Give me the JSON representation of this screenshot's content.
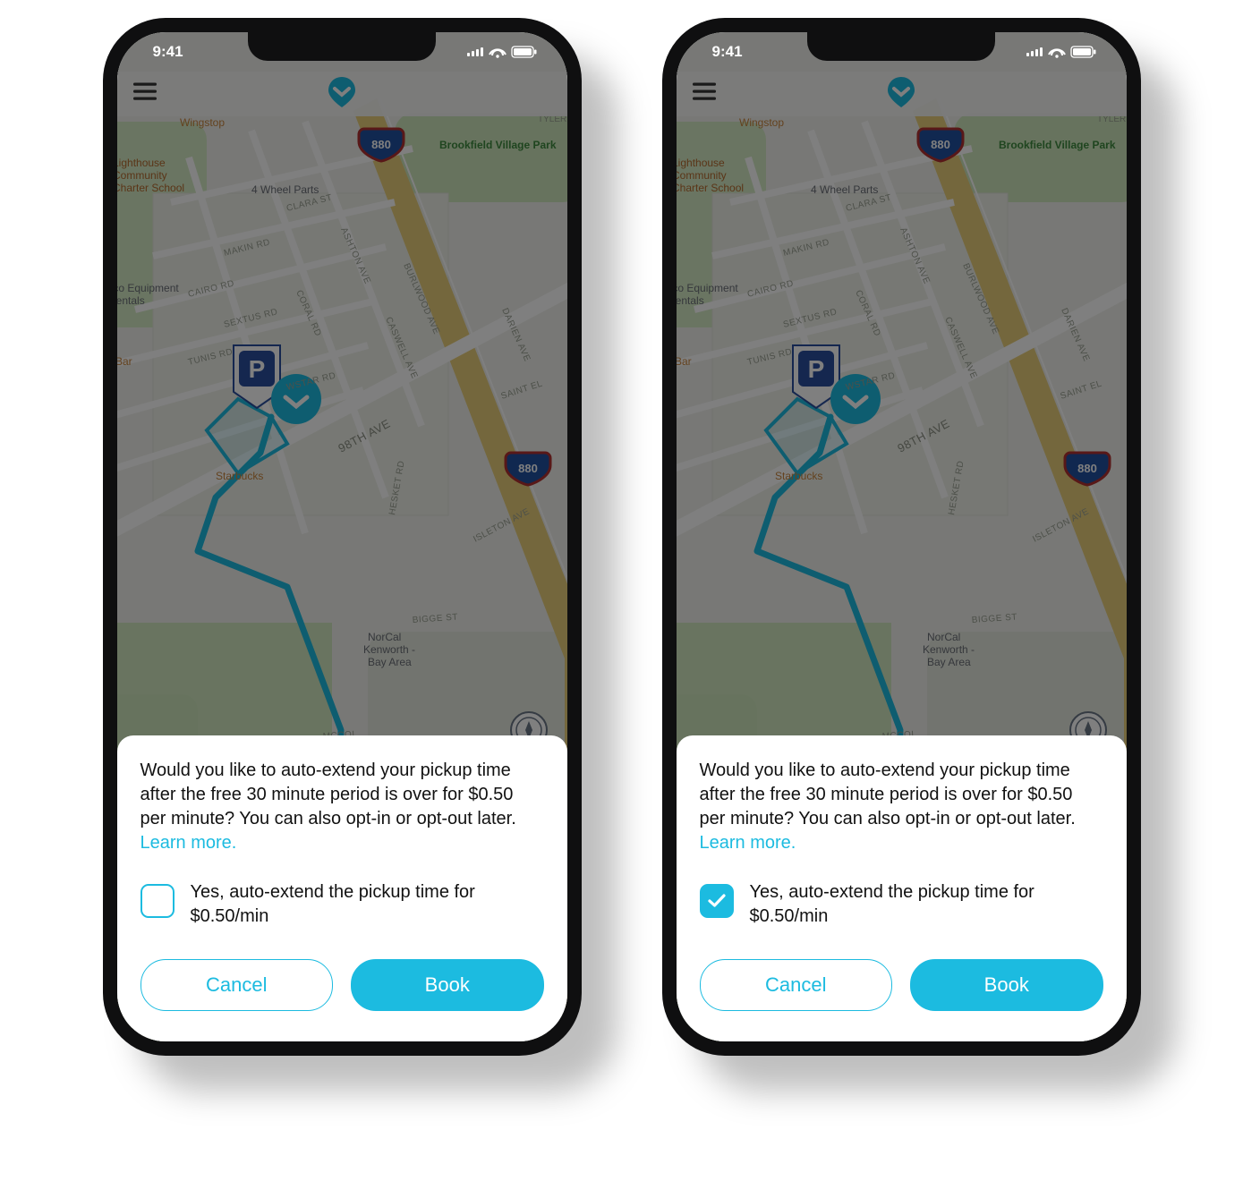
{
  "colors": {
    "accent": "#1cbbe0"
  },
  "status": {
    "time": "9:41"
  },
  "map": {
    "pois": {
      "wingstop": "Wingstop",
      "brookfield": "Brookfield Village Park",
      "lighthouse_l1": "Lighthouse",
      "lighthouse_l2": "Community",
      "lighthouse_l3": "Charter School",
      "fourwheel": "4 Wheel Parts",
      "cresco_l1": "Cresco Equipment",
      "cresco_l2": "Rentals",
      "bar": "Bar",
      "starbucks": "Starbucks",
      "norcal_l1": "NorCal",
      "norcal_l2": "Kenworth -",
      "norcal_l3": "Bay Area",
      "tyler": "TYLER"
    },
    "roads": {
      "clara": "CLARA ST",
      "ashton": "ASHTON AVE",
      "makin": "MAKIN RD",
      "burlwood": "BURLWOOD AVE",
      "cairo": "CAIRO RD",
      "coral": "CORAL RD",
      "caswell": "CASWELL AVE",
      "darien": "DARIEN AVE",
      "sextus": "SEXTUS RD",
      "tunis": "TUNIS RD",
      "wstar": "WSTAR RD",
      "saintel": "SAINT EL",
      "ninetyeighth": "98TH AVE",
      "hesket": "HESKET RD",
      "isleton": "ISLETON AVE",
      "bigge": "BIGGE ST",
      "mccoi": "MCCOI"
    },
    "highway": "880"
  },
  "sheet": {
    "body": "Would you like to auto-extend your pickup time after the free 30 minute period is over for $0.50 per minute? You can also opt-in or opt-out later. ",
    "learn_more": "Learn more.",
    "checkbox_label": "Yes, auto-extend the pickup time for $0.50/min",
    "cancel": "Cancel",
    "book": "Book"
  },
  "screens": [
    {
      "checked": false
    },
    {
      "checked": true
    }
  ]
}
